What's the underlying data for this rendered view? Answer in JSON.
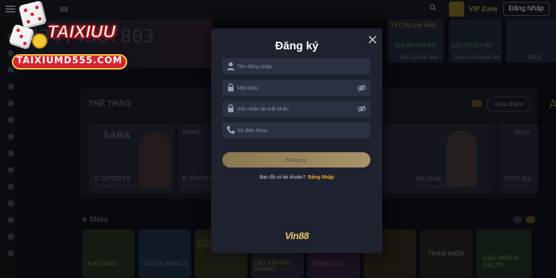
{
  "topbar": {
    "brand": "88",
    "vip_label": "VIP Zone",
    "login_label": "Đăng Nhập"
  },
  "jackpot": "334.456.803",
  "top_games": [
    {
      "name": "TÂY DU ĐẠI NÁO",
      "price": "$18.889.859.909",
      "label": "Tây Du Đại Náo"
    },
    {
      "name": "",
      "price": "$29.138.004.997",
      "label": "Thanh Xà Bạch Xà"
    },
    {
      "name": "",
      "price": "",
      "label": "Mỹ Đ"
    }
  ],
  "sports": {
    "title": "THỂ THAO",
    "see_more": "Xem thêm",
    "cards": [
      {
        "logo": "SABA",
        "name": "C-SPORTS",
        "sub": "Thể thao đỉnh cao"
      },
      {
        "logo": "SPORT",
        "name": "K-SPORT",
        "sub": "Kèo cược hấp"
      },
      {
        "logo": "",
        "name": "Hit.club",
        "sub": "Live Casino hấp dẫn"
      },
      {
        "logo": "VIVO",
        "name": "VIVO Ga",
        "sub": "Cược vui tr"
      }
    ]
  },
  "slots": {
    "title": "Slots",
    "games": [
      "KHO BÁU",
      "OCEAN WHALE",
      "CUỘC CHIẾN SĂN NẮNG",
      "THỢ SĂN HẢI VƯƠNG",
      "Night Out",
      "",
      "",
      "THÁM HIỂM",
      "ĐẶC NHIỆM DELTA"
    ]
  },
  "watermark": {
    "brand": "TAIXIUU",
    "domain": "TAIXIUMD555.COM"
  },
  "modal": {
    "title": "Đăng ký",
    "fields": {
      "username": {
        "placeholder": "Tên đăng nhập",
        "value": ""
      },
      "password": {
        "placeholder": "Mật khẩu",
        "value": ""
      },
      "confirm": {
        "placeholder": "Xác nhận lại mật khẩu",
        "value": ""
      },
      "phone": {
        "placeholder": "Số điện thoại",
        "value": ""
      }
    },
    "submit_label": "Đăng ký",
    "have_account": "Bạn đã có tài khoản?",
    "login_link": "Đăng Nhập",
    "footer_logo": "Vin88"
  },
  "colors": {
    "modal_bg": "#1f232f",
    "field_bg": "#2c3142",
    "button_gold": "#a89268",
    "link_gold": "#e8b429"
  },
  "icons": {
    "close": "close-icon",
    "username": "user-icon",
    "password": "lock-icon",
    "confirm": "lock-icon",
    "phone": "phone-icon",
    "toggle": "eye-off-icon"
  }
}
